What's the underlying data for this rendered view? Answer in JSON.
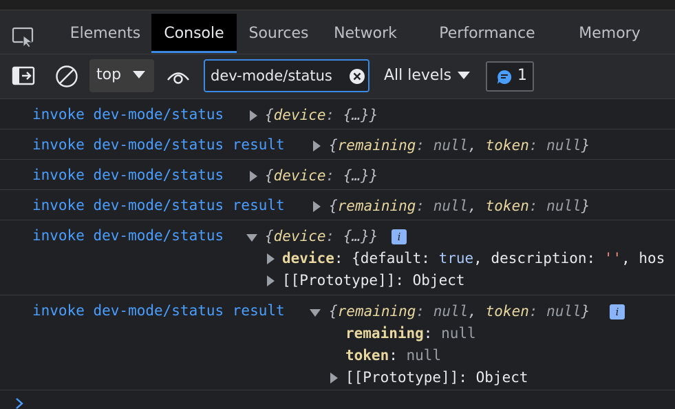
{
  "tabs": [
    {
      "label": "Elements",
      "active": false
    },
    {
      "label": "Console",
      "active": true
    },
    {
      "label": "Sources",
      "active": false
    },
    {
      "label": "Network",
      "active": false
    },
    {
      "label": "Performance",
      "active": false
    },
    {
      "label": "Memory",
      "active": false
    }
  ],
  "toolbar": {
    "context_label": "top",
    "filter_value": "dev-mode/status",
    "levels_label": "All levels",
    "message_count": "1"
  },
  "console": {
    "rows": [
      {
        "label": "invoke dev-mode/status",
        "obj": "{device: {…}}"
      },
      {
        "label": "invoke dev-mode/status result",
        "obj": "{remaining: null, token: null}"
      },
      {
        "label": "invoke dev-mode/status",
        "obj": "{device: {…}}"
      },
      {
        "label": "invoke dev-mode/status result",
        "obj": "{remaining: null, token: null}"
      },
      {
        "label": "invoke dev-mode/status",
        "obj": "{device: {…}}"
      },
      {
        "label": "invoke dev-mode/status result",
        "obj": "{remaining: null, token: null}"
      }
    ],
    "expanded1": {
      "device_key": "device",
      "device_value_prefix": "{default: ",
      "device_true": "true",
      "device_mid": ", description: ",
      "device_str": "''",
      "device_tail": ", hos",
      "prototype": "[[Prototype]]: Object"
    },
    "expanded2": {
      "remaining_key": "remaining",
      "remaining_val": "null",
      "token_key": "token",
      "token_val": "null",
      "prototype": "[[Prototype]]: Object"
    },
    "info_icon_letter": "i"
  },
  "colors": {
    "accent": "#3d8ae5",
    "link": "#4a9eff",
    "background": "#202124"
  }
}
